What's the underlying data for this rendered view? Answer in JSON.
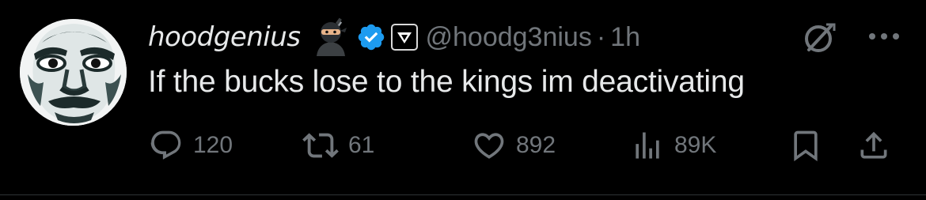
{
  "tweet": {
    "author": {
      "display_name": "hoodgenius",
      "handle": "@hoodg3nius",
      "verified": true,
      "name_emoji": "ninja-icon",
      "affiliate_badge": "affiliate-badge-icon"
    },
    "separator": "·",
    "timestamp": "1h",
    "text": "If the bucks lose to the kings im deactivating",
    "actions": {
      "replies": "120",
      "retweets": "61",
      "likes": "892",
      "views": "89K"
    }
  },
  "icons": {
    "reply": "reply-icon",
    "retweet": "retweet-icon",
    "like": "heart-icon",
    "views": "views-icon",
    "bookmark": "bookmark-icon",
    "share": "share-icon",
    "grok": "grok-icon",
    "more": "more-icon"
  },
  "colors": {
    "background": "#000000",
    "primary_text": "#e7e9ea",
    "secondary_text": "#71767b",
    "verified_blue": "#1d9bf0",
    "divider": "#2f3336"
  }
}
